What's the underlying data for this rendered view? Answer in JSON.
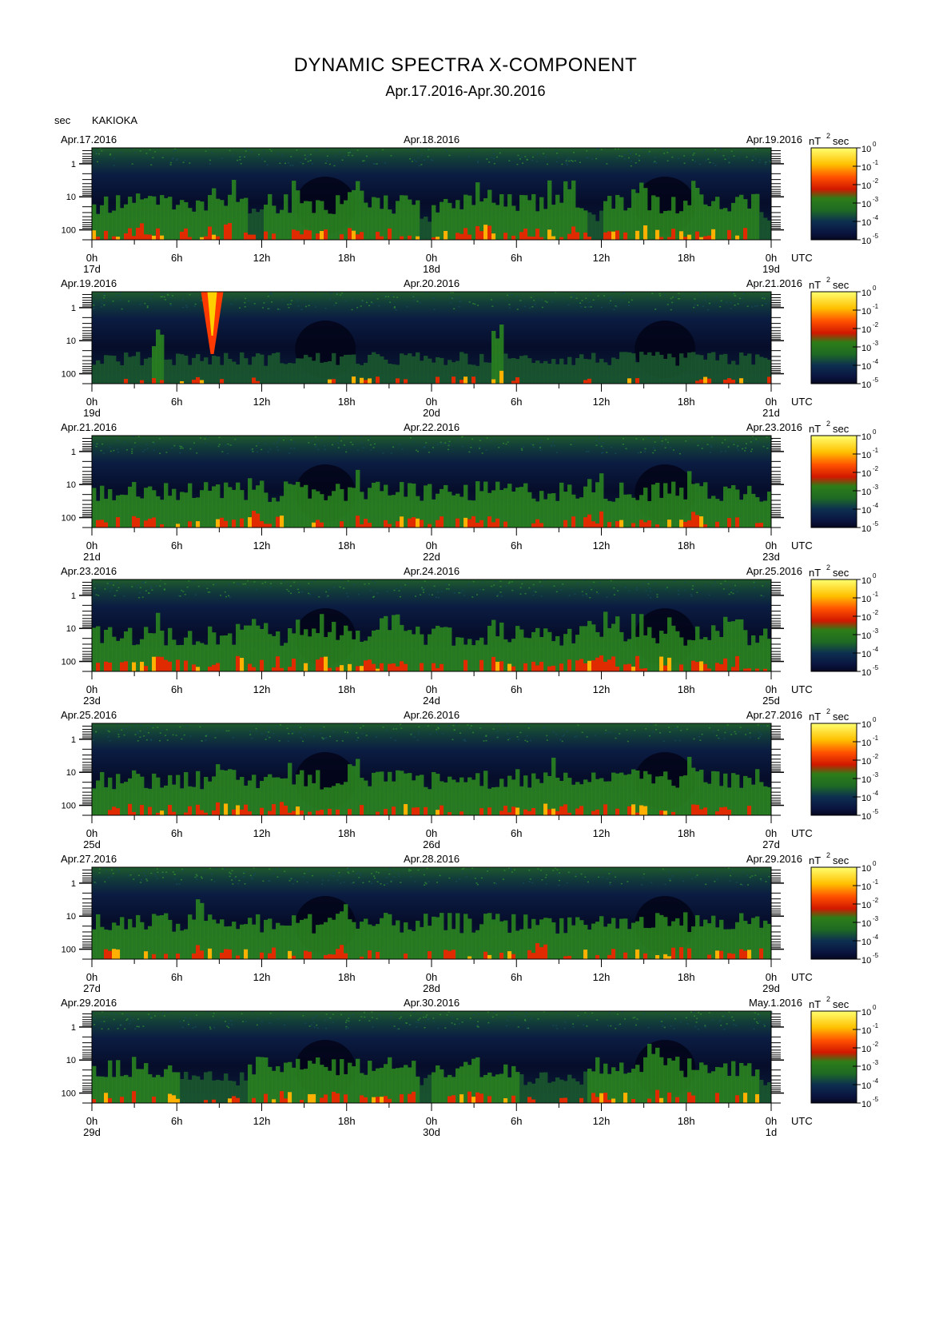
{
  "title": "DYNAMIC SPECTRA X-COMPONENT",
  "subtitle": "Apr.17.2016-Apr.30.2016",
  "y_unit_label": "sec",
  "station": "KAKIOKA",
  "colorbar_unit": "nT",
  "colorbar_unit_exp": "2",
  "colorbar_unit_suffix": "sec",
  "colorbar_labels": [
    "10",
    "10",
    "10",
    "10",
    "10",
    "10"
  ],
  "colorbar_exponents": [
    "0",
    "-1",
    "-2",
    "-3",
    "-4",
    "-5"
  ],
  "colormap": [
    "#ffff66",
    "#ffcc00",
    "#ff6600",
    "#ff2200",
    "#cc2200",
    "#2b8a1e",
    "#1d5a1a",
    "#0b2a5a",
    "#050a30"
  ],
  "y_tick_labels": [
    "1",
    "10",
    "100"
  ],
  "x_tick_labels": [
    "0h",
    "6h",
    "12h",
    "18h",
    "0h",
    "6h",
    "12h",
    "18h",
    "0h"
  ],
  "time_zone_label": "UTC",
  "chart_data": {
    "type": "heatmap",
    "title": "DYNAMIC SPECTRA X-COMPONENT",
    "subtitle": "Apr.17.2016-Apr.30.2016",
    "ylabel": "sec",
    "y_scale": "log",
    "y_ticks": [
      1,
      10,
      100
    ],
    "x_ticks_hours": [
      0,
      6,
      12,
      18,
      24,
      30,
      36,
      42,
      48
    ],
    "color_scale": "log",
    "color_range": [
      "10^-5",
      "10^0"
    ],
    "color_unit": "nT^2 sec",
    "panels": [
      {
        "left_date": "Apr.17.2016",
        "mid_date": "Apr.18.2016",
        "right_date": "Apr.19.2016",
        "day_labels": [
          "17d",
          "18d",
          "19d"
        ],
        "intensity_profile": [
          2,
          2,
          2,
          3,
          2,
          2,
          2,
          2,
          3,
          3,
          2,
          1,
          2,
          2,
          3,
          2,
          2,
          2,
          3,
          2,
          2,
          2,
          2,
          1
        ],
        "spike_hours": []
      },
      {
        "left_date": "Apr.19.2016",
        "mid_date": "Apr.20.2016",
        "right_date": "Apr.21.2016",
        "day_labels": [
          "19d",
          "20d",
          "21d"
        ],
        "intensity_profile": [
          1,
          1,
          1,
          1,
          3,
          1,
          1,
          1,
          1,
          1,
          1,
          1,
          1,
          1,
          1,
          1,
          1,
          1,
          1,
          1,
          1,
          1,
          1,
          1
        ],
        "spike_hours": [
          8.5
        ]
      },
      {
        "left_date": "Apr.21.2016",
        "mid_date": "Apr.22.2016",
        "right_date": "Apr.23.2016",
        "day_labels": [
          "21d",
          "22d",
          "23d"
        ],
        "intensity_profile": [
          2,
          2,
          2,
          2,
          2,
          2,
          2,
          2,
          2,
          2,
          2,
          3,
          2,
          2,
          2,
          2,
          2,
          2,
          3,
          2,
          2,
          2,
          2,
          2
        ],
        "spike_hours": []
      },
      {
        "left_date": "Apr.23.2016",
        "mid_date": "Apr.24.2016",
        "right_date": "Apr.25.2016",
        "day_labels": [
          "23d",
          "24d",
          "25d"
        ],
        "intensity_profile": [
          2,
          2,
          2,
          2,
          3,
          2,
          2,
          2,
          2,
          2,
          3,
          3,
          3,
          2,
          3,
          2,
          3,
          2,
          2,
          2,
          3,
          3,
          2,
          2
        ],
        "spike_hours": []
      },
      {
        "left_date": "Apr.25.2016",
        "mid_date": "Apr.26.2016",
        "right_date": "Apr.27.2016",
        "day_labels": [
          "25d",
          "26d",
          "27d"
        ],
        "intensity_profile": [
          2,
          2,
          2,
          2,
          2,
          2,
          2,
          2,
          3,
          2,
          2,
          2,
          2,
          3,
          2,
          2,
          2,
          2,
          3,
          2,
          2,
          2,
          2,
          2
        ],
        "spike_hours": []
      },
      {
        "left_date": "Apr.27.2016",
        "mid_date": "Apr.28.2016",
        "right_date": "Apr.29.2016",
        "day_labels": [
          "27d",
          "28d",
          "29d"
        ],
        "intensity_profile": [
          2,
          2,
          2,
          2,
          2,
          2,
          2,
          3,
          2,
          2,
          2,
          2,
          2,
          2,
          2,
          2,
          2,
          3,
          2,
          2,
          2,
          2,
          2,
          2
        ],
        "spike_hours": []
      },
      {
        "left_date": "Apr.29.2016",
        "mid_date": "Apr.30.2016",
        "right_date": "May.1.2016",
        "day_labels": [
          "29d",
          "30d",
          "1d"
        ],
        "intensity_profile": [
          2,
          2,
          2,
          2,
          2,
          2,
          1,
          1,
          1,
          1,
          1,
          2,
          2,
          2,
          2,
          3,
          2,
          2,
          2,
          2,
          2,
          2,
          2,
          1
        ],
        "spike_hours": []
      }
    ]
  }
}
